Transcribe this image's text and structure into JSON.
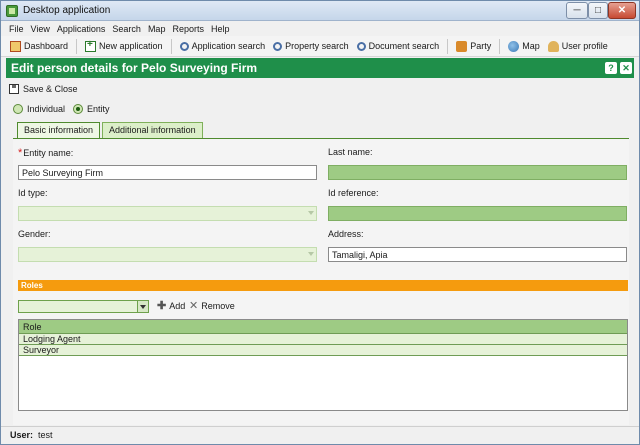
{
  "window": {
    "title": "Desktop application",
    "min": "─",
    "max": "□",
    "close": "✕"
  },
  "menu": [
    "File",
    "View",
    "Applications",
    "Search",
    "Map",
    "Reports",
    "Help"
  ],
  "toolbar": {
    "dashboard": "Dashboard",
    "new_application": "New application",
    "application_search": "Application search",
    "property_search": "Property search",
    "document_search": "Document search",
    "party": "Party",
    "map": "Map",
    "user_profile": "User profile"
  },
  "header": {
    "title": "Edit person details for Pelo Surveying Firm",
    "help": "?",
    "close": "✕"
  },
  "actions": {
    "save_close": "Save & Close"
  },
  "party_type": {
    "individual": "Individual",
    "entity": "Entity",
    "selected": "Entity"
  },
  "tabs": {
    "basic": "Basic information",
    "additional": "Additional information"
  },
  "form": {
    "entity_name_label": "Entity name:",
    "entity_name_value": "Pelo Surveying Firm",
    "last_name_label": "Last name:",
    "last_name_value": "",
    "id_type_label": "Id type:",
    "id_reference_label": "Id reference:",
    "gender_label": "Gender:",
    "address_label": "Address:",
    "address_value": "Tamaligi, Apia"
  },
  "roles": {
    "title": "Roles",
    "add": "Add",
    "remove": "Remove",
    "column": "Role",
    "rows": [
      "Lodging Agent",
      "Surveyor"
    ]
  },
  "status": {
    "user_label": "User:",
    "user_value": "test"
  },
  "colors": {
    "header_green": "#1f8f4a",
    "roles_orange": "#f59b0e",
    "field_green": "#9ecb84"
  }
}
